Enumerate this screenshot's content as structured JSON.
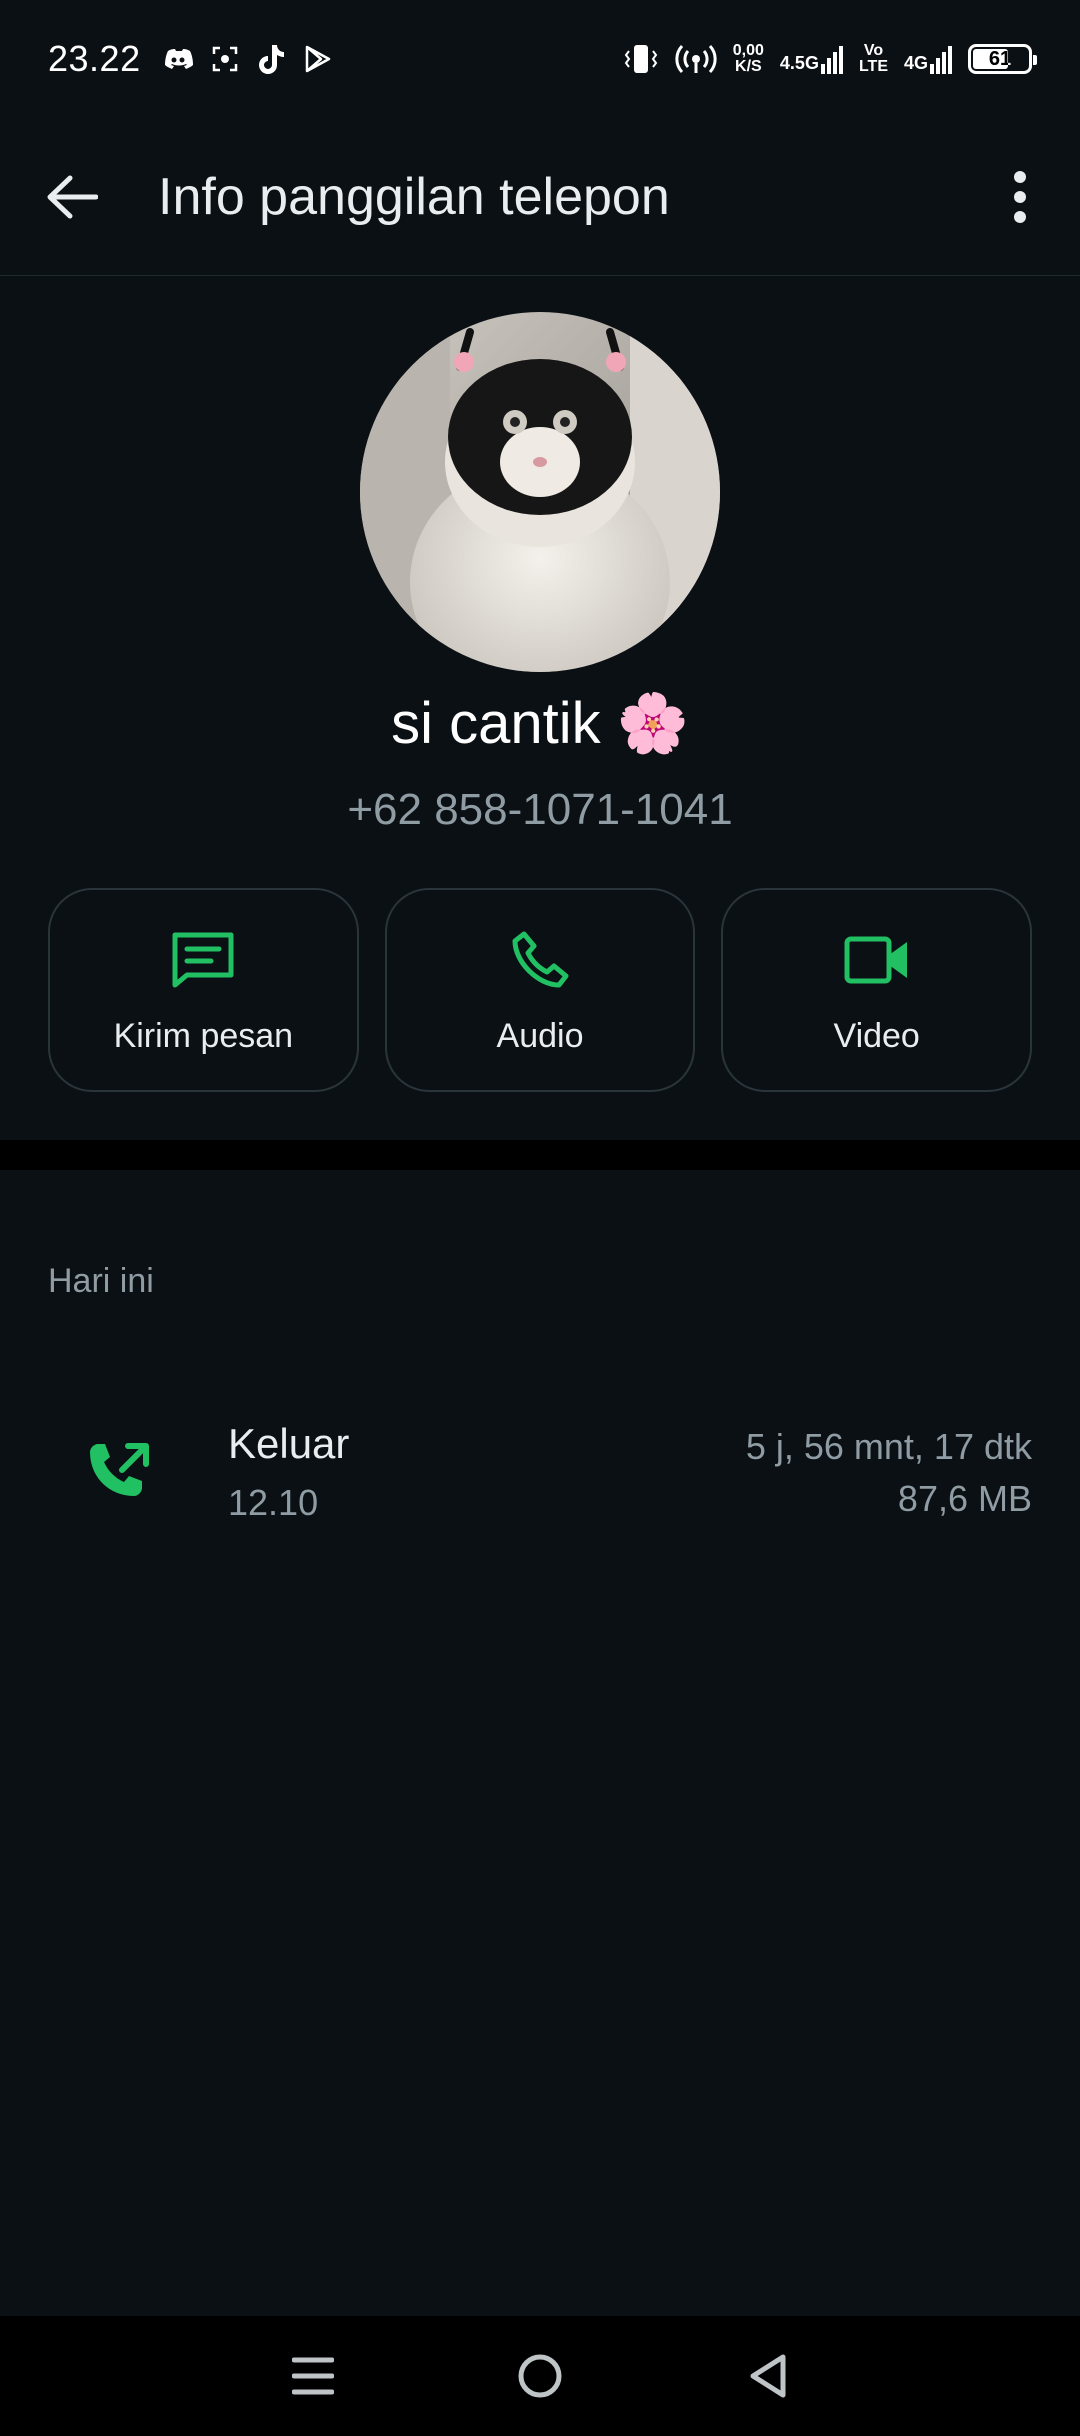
{
  "status_bar": {
    "time": "23.22",
    "net_speed_value": "0,00",
    "net_speed_unit": "K/S",
    "network1": "4.5G",
    "volte_top": "Vo",
    "volte_bottom": "LTE",
    "network2": "4G",
    "battery": "61"
  },
  "header": {
    "title": "Info panggilan telepon"
  },
  "contact": {
    "name": "si cantik 🌸",
    "phone": "+62 858-1071-1041"
  },
  "actions": [
    {
      "label": "Kirim pesan",
      "icon": "message-icon"
    },
    {
      "label": "Audio",
      "icon": "phone-icon"
    },
    {
      "label": "Video",
      "icon": "video-icon"
    }
  ],
  "section": {
    "label": "Hari ini"
  },
  "calls": [
    {
      "type": "Keluar",
      "time": "12.10",
      "duration": "5 j, 56 mnt, 17 dtk",
      "size": "87,6 MB",
      "icon": "outgoing-call-icon"
    }
  ],
  "colors": {
    "accent": "#21c063",
    "background": "#0b1014",
    "muted_text": "#8f9ca3"
  }
}
